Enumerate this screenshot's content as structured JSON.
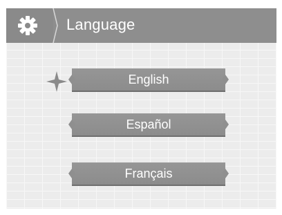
{
  "header": {
    "title": "Language",
    "icon": "gear-icon"
  },
  "languages": [
    {
      "label": "English",
      "selected": true
    },
    {
      "label": "Español",
      "selected": false
    },
    {
      "label": "Français",
      "selected": false
    }
  ],
  "selection_indicator": "star-icon",
  "colors": {
    "header_bg": "#8e8e8e",
    "button_bg": "#8f8f8f",
    "background": "#ececec",
    "text": "#ffffff"
  }
}
